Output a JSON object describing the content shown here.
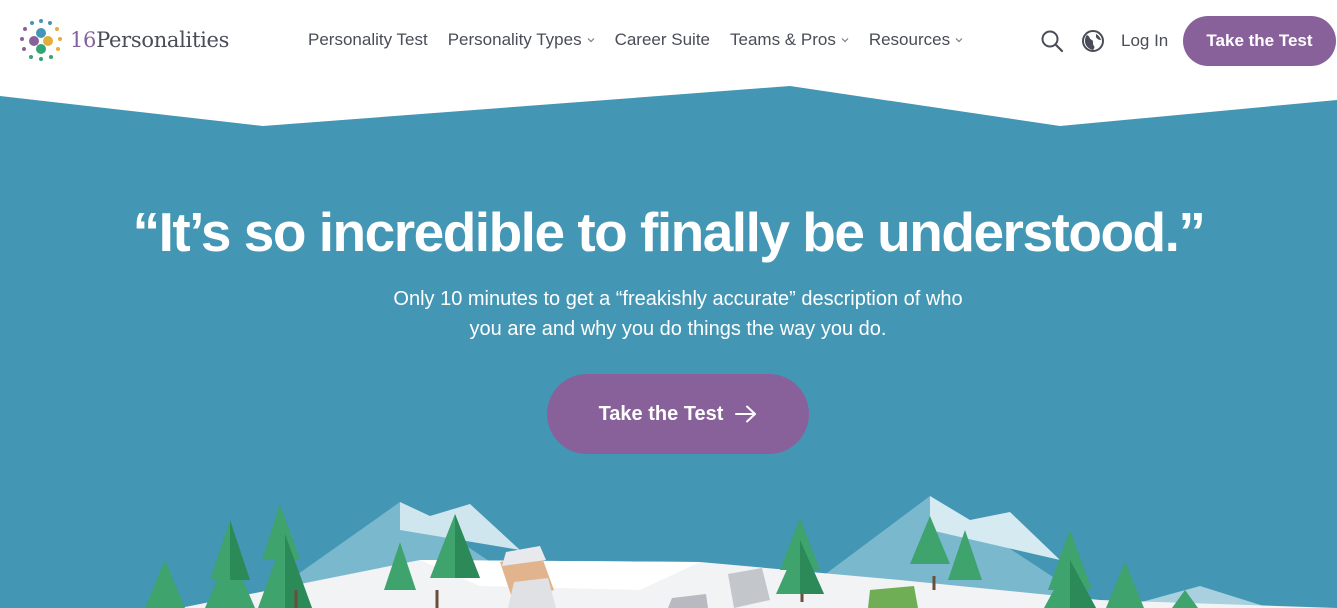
{
  "brand": {
    "logo_num": "16",
    "logo_word": "Personalities"
  },
  "nav": {
    "items": [
      {
        "label": "Personality Test",
        "dropdown": false
      },
      {
        "label": "Personality Types",
        "dropdown": true
      },
      {
        "label": "Career Suite",
        "dropdown": false
      },
      {
        "label": "Teams & Pros",
        "dropdown": true
      },
      {
        "label": "Resources",
        "dropdown": true
      }
    ],
    "login_label": "Log In",
    "cta_label": "Take the Test",
    "search_icon": "search-icon",
    "globe_icon": "globe-icon"
  },
  "hero": {
    "headline": "“It’s so incredible to finally be understood.”",
    "subline_1": "Only 10 minutes to get a “freakishly accurate” description of who",
    "subline_2": "you are and why you do things the way you do.",
    "cta_label": "Take the Test",
    "cta_icon": "arrow-right-icon"
  },
  "colors": {
    "hero_blue": "#4396b4",
    "accent_purple": "#88619a",
    "nav_text": "#4a4d57"
  }
}
